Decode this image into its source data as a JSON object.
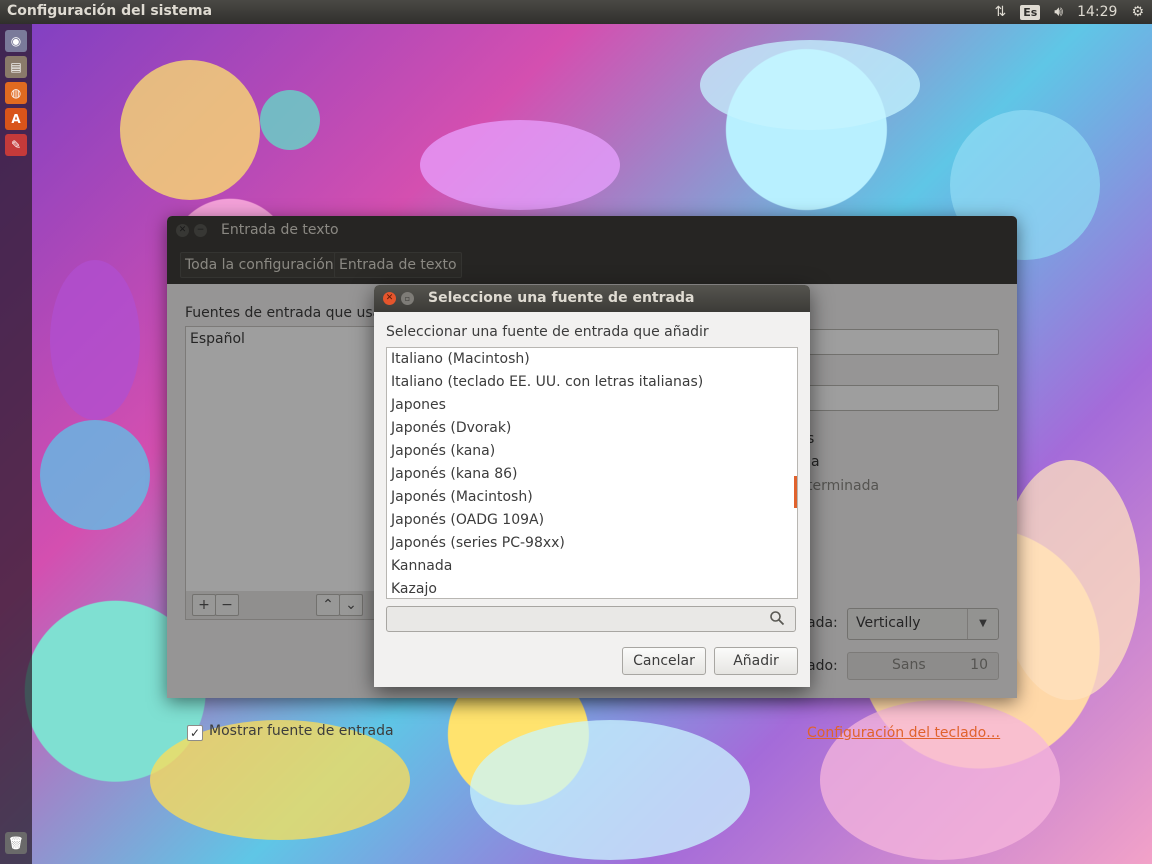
{
  "top_panel": {
    "title": "Configuración del sistema",
    "keyboard_indicator": "Es",
    "clock": "14:29"
  },
  "launcher": {
    "items": [
      "dash-icon",
      "files-icon",
      "firefox-icon",
      "software-center-icon",
      "system-settings-icon",
      "trash-icon"
    ]
  },
  "main_window": {
    "title": "Entrada de texto",
    "breadcrumbs": [
      "Toda la configuración",
      "Entrada de texto"
    ],
    "sources_label": "Fuentes de entrada que usar",
    "sources": [
      "Español"
    ],
    "right_partial": {
      "line1": "s",
      "line2": "a",
      "line3": "terminada",
      "orientation_label": "ada:",
      "orientation_value": "Vertically",
      "font_label": "ado:",
      "font_name": "Sans",
      "font_size": "10"
    },
    "show_source_label": "Mostrar fuente de entrada",
    "keyboard_settings_link": "Configuración del teclado…"
  },
  "dialog": {
    "title": "Seleccione una fuente de entrada",
    "subtitle": "Seleccionar una fuente de entrada que añadir",
    "items": [
      "Italiano (Macintosh)",
      "Italiano (teclado EE. UU. con letras italianas)",
      "Japones",
      "Japonés (Dvorak)",
      "Japonés (kana)",
      "Japonés (kana 86)",
      "Japonés (Macintosh)",
      "Japonés (OADG 109A)",
      "Japonés (series PC-98xx)",
      "Kannada",
      "Kazajo"
    ],
    "search_placeholder": "",
    "cancel_label": "Cancelar",
    "add_label": "Añadir"
  },
  "colors": {
    "accent": "#e0622d",
    "panel": "#3a3935",
    "close_button": "#e5552c"
  }
}
